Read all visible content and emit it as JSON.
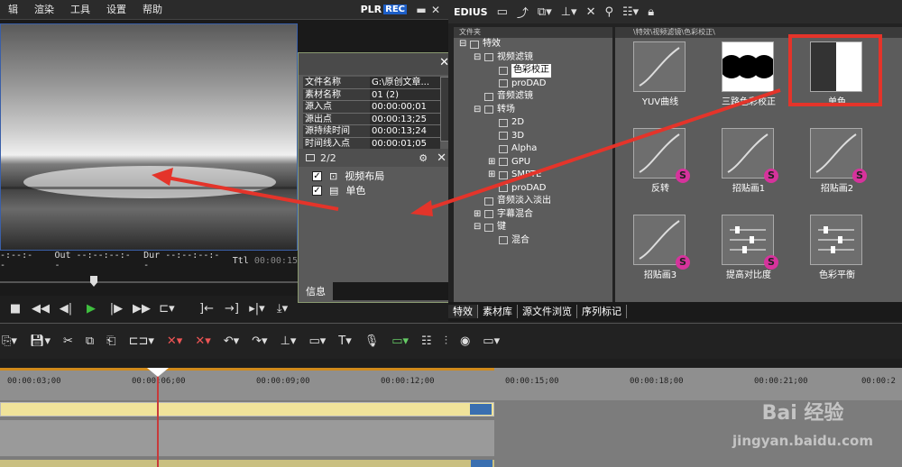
{
  "menu": {
    "items": [
      "辑",
      "渲染",
      "工具",
      "设置",
      "帮助"
    ],
    "plr": "PLR",
    "rec": "REC",
    "minimize": "▬",
    "close": "✕"
  },
  "player": {
    "in_label": "-:--:--",
    "out_label": "Out --:--:--:--",
    "dur_label": "Dur --:--:--:--",
    "ttl_label": "Ttl",
    "ttl_value": "00:00:15"
  },
  "info": {
    "rows": [
      {
        "key": "文件名称",
        "value": "G:\\原创文章..."
      },
      {
        "key": "素材名称",
        "value": "01 (2)"
      },
      {
        "key": "源入点",
        "value": "00:00:00;01"
      },
      {
        "key": "源出点",
        "value": "00:00:13;25"
      },
      {
        "key": "源持续时间",
        "value": "00:00:13;24"
      },
      {
        "key": "时间线入点",
        "value": "00:00:01;05"
      }
    ],
    "page": "2/2",
    "layers": [
      {
        "label": "视频布局"
      },
      {
        "label": "单色"
      }
    ],
    "footer": "信息"
  },
  "fx": {
    "title": "EDIUS",
    "tree_header": "文件夹",
    "path": "\\特效\\视频滤镜\\色彩校正\\",
    "tree": [
      {
        "label": "特效",
        "indent": 0,
        "sign": "⊟"
      },
      {
        "label": "视频滤镜",
        "indent": 1,
        "sign": "⊟"
      },
      {
        "label": "色彩校正",
        "indent": 2,
        "sign": ""
      },
      {
        "label": "proDAD",
        "indent": 2,
        "sign": ""
      },
      {
        "label": "音频滤镜",
        "indent": 1,
        "sign": ""
      },
      {
        "label": "转场",
        "indent": 1,
        "sign": "⊟"
      },
      {
        "label": "2D",
        "indent": 2,
        "sign": ""
      },
      {
        "label": "3D",
        "indent": 2,
        "sign": ""
      },
      {
        "label": "Alpha",
        "indent": 2,
        "sign": ""
      },
      {
        "label": "GPU",
        "indent": 2,
        "sign": "⊞"
      },
      {
        "label": "SMPTE",
        "indent": 2,
        "sign": "⊞"
      },
      {
        "label": "proDAD",
        "indent": 2,
        "sign": ""
      },
      {
        "label": "音频淡入淡出",
        "indent": 1,
        "sign": ""
      },
      {
        "label": "字幕混合",
        "indent": 1,
        "sign": "⊞"
      },
      {
        "label": "键",
        "indent": 1,
        "sign": "⊟"
      },
      {
        "label": "混合",
        "indent": 2,
        "sign": ""
      }
    ],
    "tiles": [
      {
        "label": "YUV曲线",
        "badge": ""
      },
      {
        "label": "三路色彩校正",
        "badge": ""
      },
      {
        "label": "单色",
        "badge": ""
      },
      {
        "label": "反转",
        "badge": "S"
      },
      {
        "label": "招贴画1",
        "badge": "S"
      },
      {
        "label": "招贴画2",
        "badge": "S"
      },
      {
        "label": "招贴画3",
        "badge": "S"
      },
      {
        "label": "提高对比度",
        "badge": "S"
      },
      {
        "label": "色彩平衡",
        "badge": ""
      }
    ],
    "tabs": [
      "特效",
      "素材库",
      "源文件浏览",
      "序列标记"
    ]
  },
  "timeline": {
    "ticks": [
      "00:00:03;00",
      "00:00:06;00",
      "00:00:09;00",
      "00:00:12;00",
      "00:00:15;00",
      "00:00:18;00",
      "00:00:21;00",
      "00:00:2"
    ]
  },
  "watermark": {
    "brand": "Bai 经验",
    "url": "jingyan.baidu.com"
  }
}
